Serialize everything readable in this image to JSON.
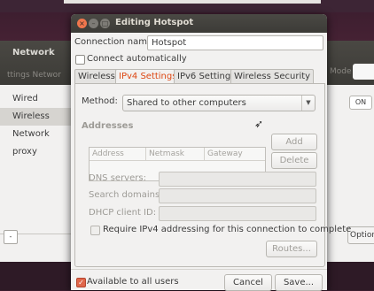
{
  "background": {
    "title": "Network",
    "tabs_text": "ttings  Networ",
    "mode_label": "Mode",
    "list_items": [
      "Wired",
      "Wireless",
      "Network proxy"
    ],
    "on_label": "ON",
    "options_label": "Option"
  },
  "dialog": {
    "title": "Editing Hotspot",
    "connection_name_label": "Connection name:",
    "connection_name_value": "Hotspot",
    "connect_auto_label": "Connect automatically",
    "tabs": [
      "Wireless",
      "IPv4 Settings",
      "IPv6 Settings",
      "Wireless Security"
    ],
    "active_tab": "IPv4 Settings",
    "method_label": "Method:",
    "method_value": "Shared to other computers",
    "addresses_label": "Addresses",
    "columns": [
      "Address",
      "Netmask",
      "Gateway"
    ],
    "add_label": "Add",
    "delete_label": "Delete",
    "dns_label": "DNS servers:",
    "search_domains_label": "Search domains:",
    "dhcp_label": "DHCP client ID:",
    "require_ipv4_label": "Require IPv4 addressing for this connection to complete",
    "routes_label": "Routes...",
    "available_label": "Available to all users",
    "cancel_label": "Cancel",
    "save_label": "Save..."
  },
  "colors": {
    "accent": "#dd4814",
    "titlebar": "#3c3b37",
    "close": "#f0764d"
  }
}
